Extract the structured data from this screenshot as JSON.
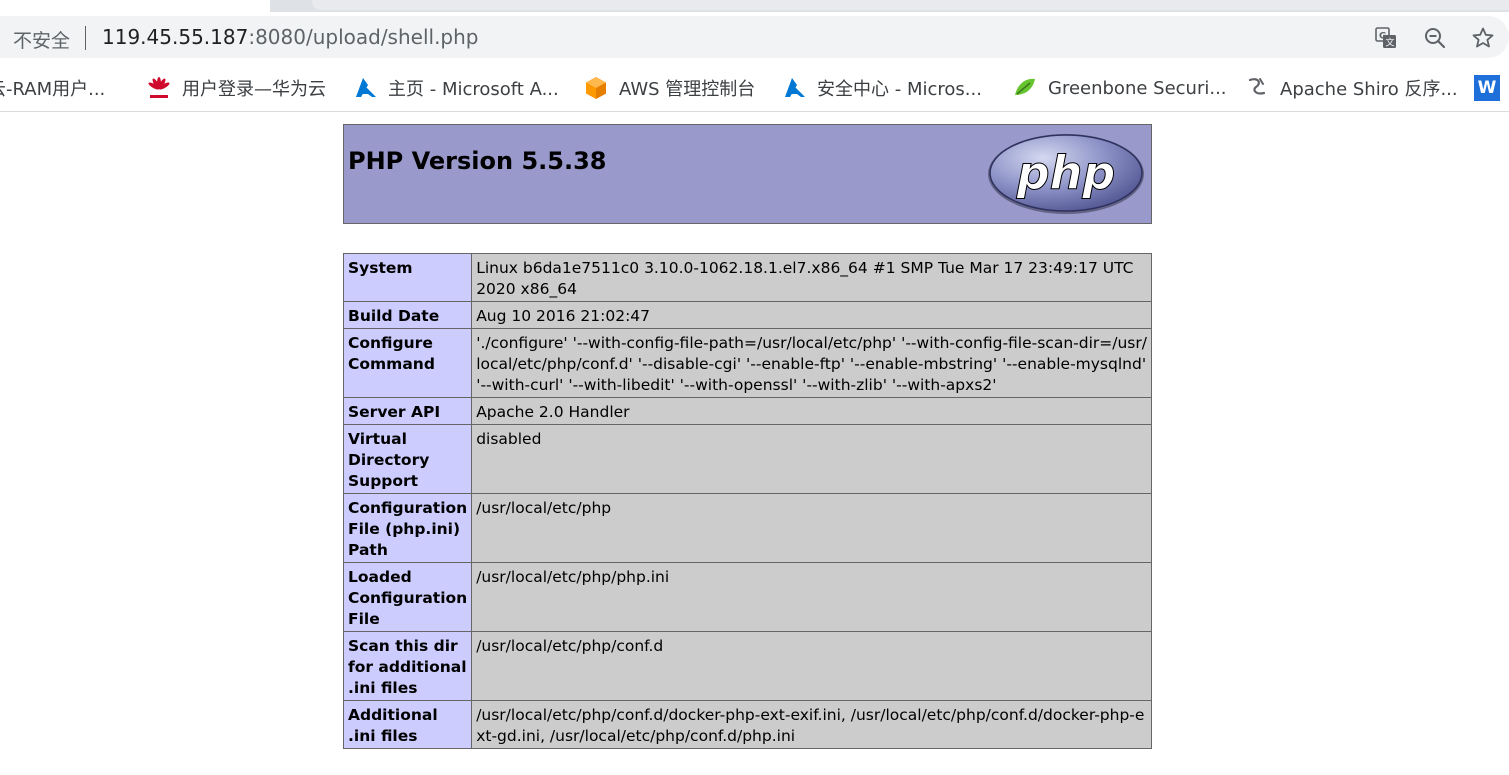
{
  "browser": {
    "security_label": "不安全",
    "url_host": "119.45.55.187",
    "url_rest": ":8080/upload/shell.php"
  },
  "bookmarks": [
    {
      "label": "云-RAM用户...",
      "icon": "cloud-icon"
    },
    {
      "label": "用户登录—华为云",
      "icon": "huawei-icon"
    },
    {
      "label": "主页 - Microsoft A...",
      "icon": "azure-icon"
    },
    {
      "label": "AWS 管理控制台",
      "icon": "aws-icon"
    },
    {
      "label": "安全中心 - Micros...",
      "icon": "azure-icon"
    },
    {
      "label": "Greenbone Securi...",
      "icon": "greenbone-icon"
    },
    {
      "label": "Apache Shiro 反序...",
      "icon": "shiro-icon"
    },
    {
      "label": "W",
      "icon": "w-icon"
    }
  ],
  "phpinfo": {
    "title": "PHP Version 5.5.38",
    "logo_text": "php",
    "rows": [
      {
        "key": "System",
        "value": "Linux b6da1e7511c0 3.10.0-1062.18.1.el7.x86_64 #1 SMP Tue Mar 17 23:49:17 UTC 2020 x86_64"
      },
      {
        "key": "Build Date",
        "value": "Aug 10 2016 21:02:47"
      },
      {
        "key": "Configure Command",
        "value": "'./configure' '--with-config-file-path=/usr/local/etc/php' '--with-config-file-scan-dir=/usr/local/etc/php/conf.d' '--disable-cgi' '--enable-ftp' '--enable-mbstring' '--enable-mysqlnd' '--with-curl' '--with-libedit' '--with-openssl' '--with-zlib' '--with-apxs2'"
      },
      {
        "key": "Server API",
        "value": "Apache 2.0 Handler"
      },
      {
        "key": "Virtual Directory Support",
        "value": "disabled"
      },
      {
        "key": "Configuration File (php.ini) Path",
        "value": "/usr/local/etc/php"
      },
      {
        "key": "Loaded Configuration File",
        "value": "/usr/local/etc/php/php.ini"
      },
      {
        "key": "Scan this dir for additional .ini files",
        "value": "/usr/local/etc/php/conf.d"
      },
      {
        "key": "Additional .ini files",
        "value": "/usr/local/etc/php/conf.d/docker-php-ext-exif.ini, /usr/local/etc/php/conf.d/docker-php-ext-gd.ini, /usr/local/etc/php/conf.d/php.ini"
      }
    ]
  },
  "colors": {
    "header_bg": "#9999cc",
    "key_bg": "#ccccff",
    "value_bg": "#cccccc",
    "azure_blue": "#0078d4",
    "aws_orange": "#ff9900",
    "huawei_red": "#cf0a2c"
  }
}
